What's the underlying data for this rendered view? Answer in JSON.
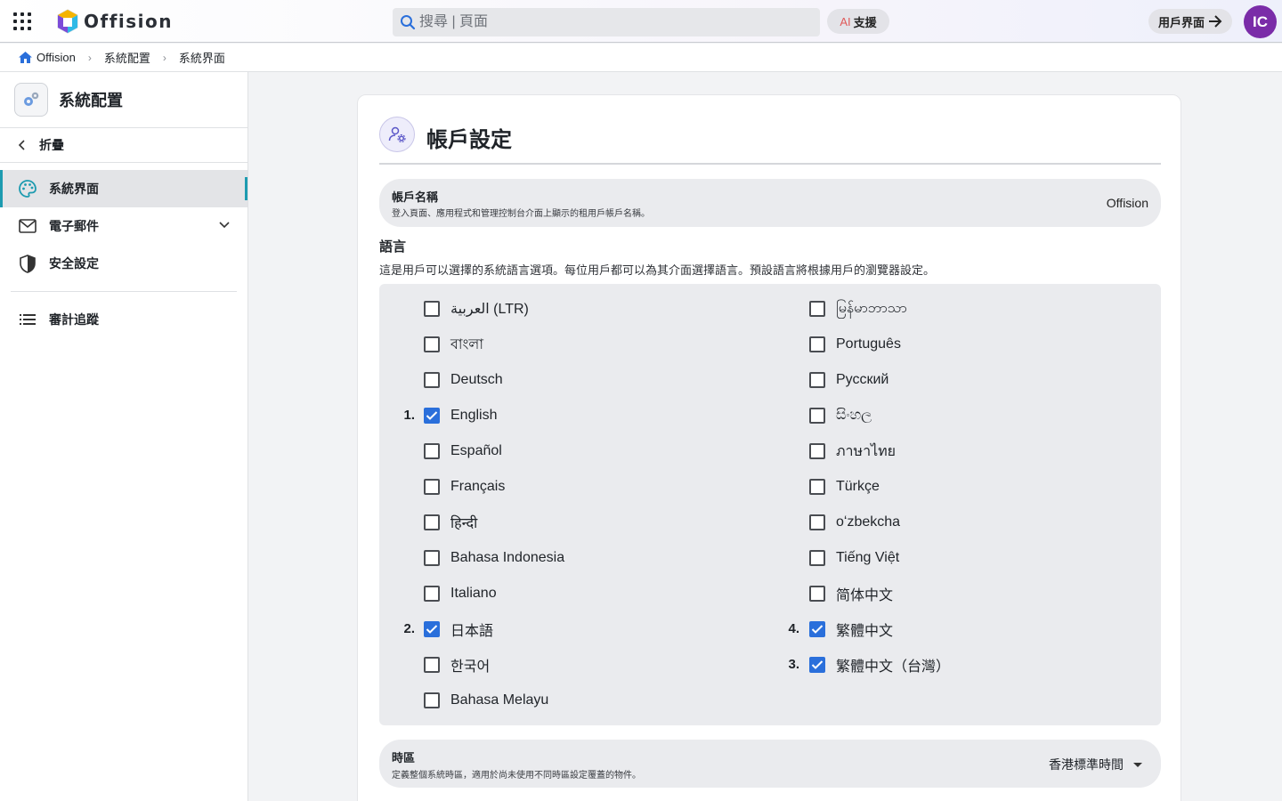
{
  "topbar": {
    "logo_text": "Offision",
    "search_placeholder": "搜尋 | 頁面",
    "ai_label": "AI",
    "support_label": "支援",
    "user_ui_label": "用戶界面",
    "avatar_initials": "IC",
    "avatar_color": "#7a2ca8"
  },
  "breadcrumb": {
    "items": [
      "Offision",
      "系統配置",
      "系統界面"
    ]
  },
  "sidebar": {
    "title": "系統配置",
    "collapse_label": "折疊",
    "items": [
      {
        "label": "系統界面",
        "icon": "palette-icon",
        "active": true
      },
      {
        "label": "電子郵件",
        "icon": "mail-icon",
        "expandable": true
      },
      {
        "label": "安全設定",
        "icon": "shield-icon"
      },
      {
        "label": "審計追蹤",
        "icon": "list-icon"
      }
    ],
    "accent_color": "#1d9bb0"
  },
  "card": {
    "title": "帳戶設定",
    "account_name": {
      "label": "帳戶名稱",
      "description": "登入頁面、應用程式和管理控制台介面上顯示的租用戶帳戶名稱。",
      "value": "Offision"
    },
    "language": {
      "title": "語言",
      "description": "這是用戶可以選擇的系統語言選項。每位用戶都可以為其介面選擇語言。預設語言將根據用戶的瀏覽器設定。",
      "left": [
        {
          "label": "العربية (LTR)",
          "checked": false,
          "order": ""
        },
        {
          "label": "বাংলা",
          "checked": false,
          "order": ""
        },
        {
          "label": "Deutsch",
          "checked": false,
          "order": ""
        },
        {
          "label": "English",
          "checked": true,
          "order": "1."
        },
        {
          "label": "Español",
          "checked": false,
          "order": ""
        },
        {
          "label": "Français",
          "checked": false,
          "order": ""
        },
        {
          "label": "हिन्दी",
          "checked": false,
          "order": ""
        },
        {
          "label": "Bahasa Indonesia",
          "checked": false,
          "order": ""
        },
        {
          "label": "Italiano",
          "checked": false,
          "order": ""
        },
        {
          "label": "日本語",
          "checked": true,
          "order": "2."
        },
        {
          "label": "한국어",
          "checked": false,
          "order": ""
        },
        {
          "label": "Bahasa Melayu",
          "checked": false,
          "order": ""
        }
      ],
      "right": [
        {
          "label": "မြန်မာဘာသာ",
          "checked": false,
          "order": ""
        },
        {
          "label": "Português",
          "checked": false,
          "order": ""
        },
        {
          "label": "Русский",
          "checked": false,
          "order": ""
        },
        {
          "label": "සිංහල",
          "checked": false,
          "order": ""
        },
        {
          "label": "ภาษาไทย",
          "checked": false,
          "order": ""
        },
        {
          "label": "Türkçe",
          "checked": false,
          "order": ""
        },
        {
          "label": "oʻzbekcha",
          "checked": false,
          "order": ""
        },
        {
          "label": "Tiếng Việt",
          "checked": false,
          "order": ""
        },
        {
          "label": "简体中文",
          "checked": false,
          "order": ""
        },
        {
          "label": "繁體中文",
          "checked": true,
          "order": "4."
        },
        {
          "label": "繁體中文（台灣）",
          "checked": true,
          "order": "3."
        }
      ],
      "checkbox_color": "#2a6fdb"
    },
    "timezone": {
      "label": "時區",
      "description": "定義整個系統時區，適用於尚未使用不同時區設定覆蓋的物件。",
      "value": "香港標準時間"
    }
  }
}
